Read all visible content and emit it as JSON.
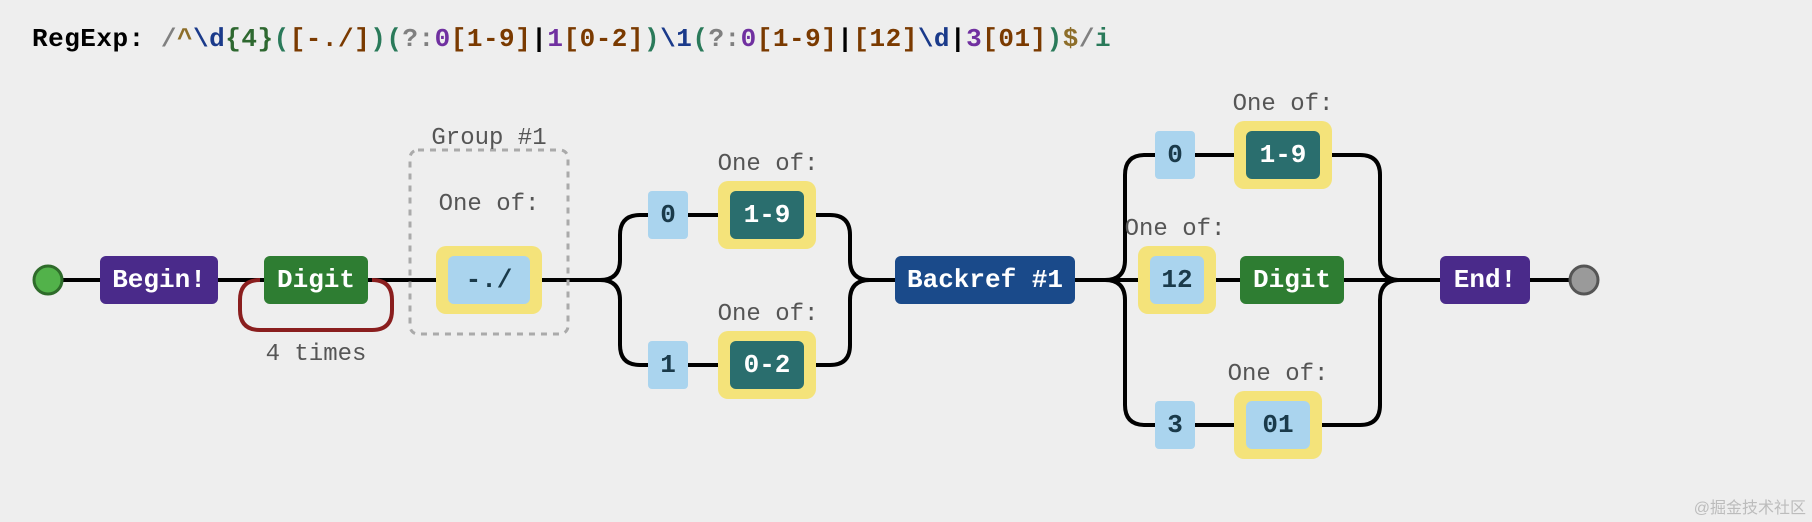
{
  "header": {
    "label": "RegExp:",
    "regex_parts": [
      {
        "t": "/",
        "c": "re-slash"
      },
      {
        "t": "^",
        "c": "re-anchor"
      },
      {
        "t": "\\d",
        "c": "re-esc"
      },
      {
        "t": "{4}",
        "c": "re-quant"
      },
      {
        "t": "(",
        "c": "re-grp"
      },
      {
        "t": "[-./]",
        "c": "re-chcls"
      },
      {
        "t": ")",
        "c": "re-grp"
      },
      {
        "t": "(",
        "c": "re-grp"
      },
      {
        "t": "?:",
        "c": "re-ncg"
      },
      {
        "t": "0",
        "c": "re-lit"
      },
      {
        "t": "[1-9]",
        "c": "re-chcls"
      },
      {
        "t": "|",
        "c": "re-alt"
      },
      {
        "t": "1",
        "c": "re-lit"
      },
      {
        "t": "[0-2]",
        "c": "re-chcls"
      },
      {
        "t": ")",
        "c": "re-grp"
      },
      {
        "t": "\\1",
        "c": "re-esc"
      },
      {
        "t": "(",
        "c": "re-grp"
      },
      {
        "t": "?:",
        "c": "re-ncg"
      },
      {
        "t": "0",
        "c": "re-lit"
      },
      {
        "t": "[1-9]",
        "c": "re-chcls"
      },
      {
        "t": "|",
        "c": "re-alt"
      },
      {
        "t": "[12]",
        "c": "re-chcls"
      },
      {
        "t": "\\d",
        "c": "re-esc"
      },
      {
        "t": "|",
        "c": "re-alt"
      },
      {
        "t": "3",
        "c": "re-lit"
      },
      {
        "t": "[01]",
        "c": "re-chcls"
      },
      {
        "t": ")",
        "c": "re-grp"
      },
      {
        "t": "$",
        "c": "re-anchor"
      },
      {
        "t": "/",
        "c": "re-slash"
      },
      {
        "t": "i",
        "c": "re-flag"
      }
    ]
  },
  "diagram": {
    "begin": "Begin!",
    "end": "End!",
    "digit": "Digit",
    "loop_label": "4 times",
    "group1": {
      "title": "Group #1",
      "oneof": "One of:",
      "chars": "-./"
    },
    "alt1": {
      "top": {
        "lit": "0",
        "oneof": "One of:",
        "range": "1-9"
      },
      "bot": {
        "lit": "1",
        "oneof": "One of:",
        "range": "0-2"
      }
    },
    "backref": "Backref #1",
    "alt2": {
      "top": {
        "lit": "0",
        "oneof": "One of:",
        "range": "1-9"
      },
      "mid": {
        "lit": "12",
        "oneof": "One of:",
        "digit": "Digit"
      },
      "bot": {
        "lit": "3",
        "oneof": "One of:",
        "range": "01"
      }
    }
  },
  "watermark": "@掘金技术社区"
}
